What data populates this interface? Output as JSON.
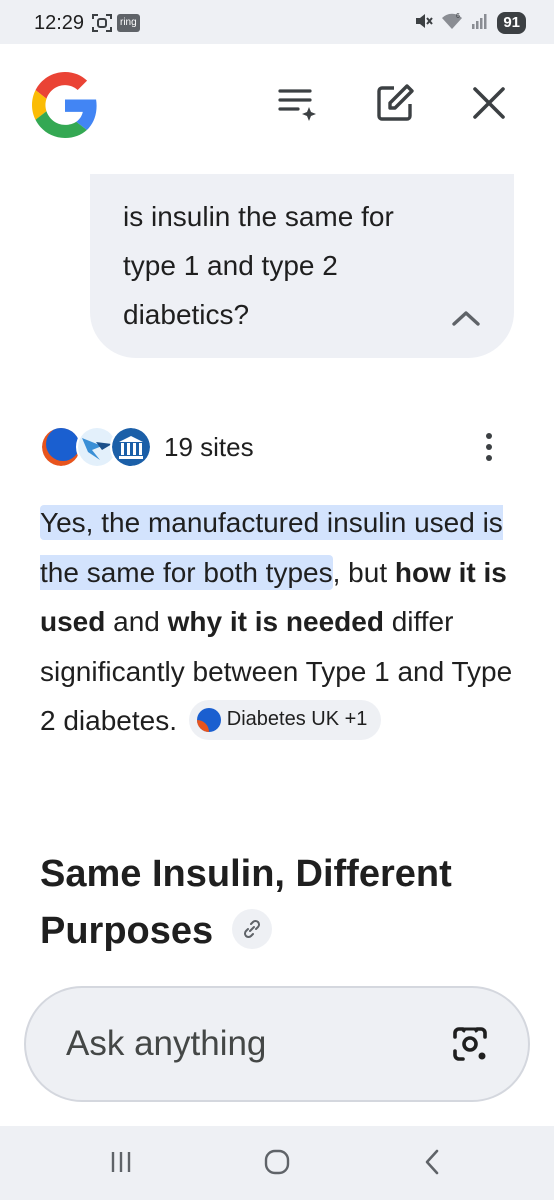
{
  "status_bar": {
    "time": "12:29",
    "ring_badge": "ring",
    "battery": "91",
    "icons": [
      "screenshot-icon",
      "mute-icon",
      "wifi-icon",
      "signal-icon",
      "battery-icon"
    ]
  },
  "header": {
    "logo": "google-g-logo",
    "actions": [
      "history-icon",
      "new-chat-icon",
      "close-icon"
    ]
  },
  "query": {
    "text": "is insulin the same for type 1 and type 2 diabetics?"
  },
  "sources": {
    "count_label": "19 sites"
  },
  "answer": {
    "highlight": "Yes, the manufactured insulin used is the same for both types",
    "after_highlight": ",",
    "p1": " but ",
    "b1": "how it is used",
    "p2": " and ",
    "b2": "why it is needed",
    "p3": " differ significantly between Type 1 and Type 2 diabetes.",
    "chip_label": "Diabetes UK +1"
  },
  "section": {
    "heading": "Same Insulin, Different Purposes"
  },
  "ask": {
    "placeholder": "Ask anything"
  },
  "colors": {
    "highlight": "#d3e3fd",
    "bubble": "#eef0f5",
    "google_blue": "#4285F4",
    "google_red": "#EA4335",
    "google_yellow": "#FBBC05",
    "google_green": "#34A853"
  }
}
